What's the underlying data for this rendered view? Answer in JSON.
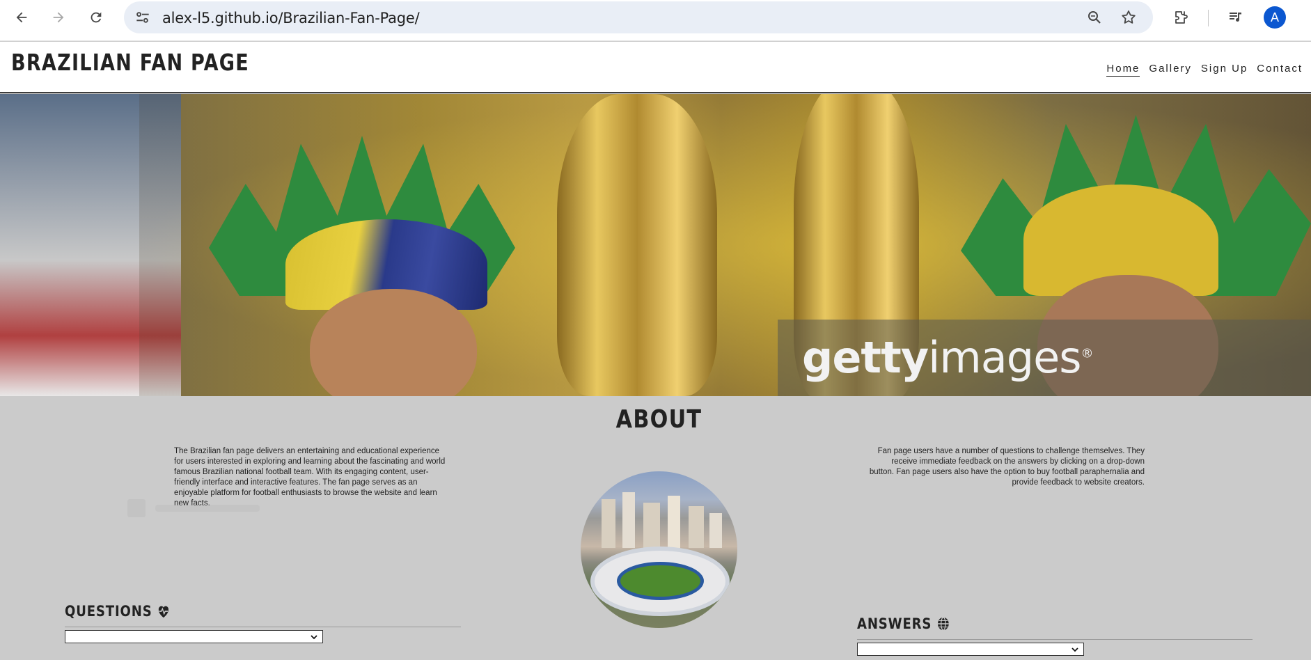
{
  "browser": {
    "url": "alex-l5.github.io/Brazilian-Fan-Page/",
    "avatar_letter": "A"
  },
  "site": {
    "brand": "BRAZILIAN FAN PAGE",
    "nav": [
      {
        "label": "Home",
        "active": true
      },
      {
        "label": "Gallery",
        "active": false
      },
      {
        "label": "Sign Up",
        "active": false
      },
      {
        "label": "Contact",
        "active": false
      }
    ]
  },
  "hero": {
    "watermark_bold": "getty",
    "watermark_light": "images",
    "watermark_mark": "®"
  },
  "about": {
    "title": "ABOUT",
    "left_text": "The Brazilian fan page delivers an entertaining and educational experience for users interested in exploring and learning about the fascinating and world famous Brazilian national football team. With its engaging content, user-friendly interface and interactive features. The fan page serves as an enjoyable platform for football enthusiasts to browse the website and learn new facts.",
    "right_text": "Fan page users have a number of questions to challenge themselves. They receive immediate feedback on the answers by clicking on a drop-down button. Fan page users also have the option to buy football paraphernalia and provide feedback to website creators."
  },
  "questions": {
    "title": "QUESTIONS",
    "icon": "heart-pulse-icon",
    "selected": ""
  },
  "answers": {
    "title": "ANSWERS",
    "icon": "globe-icon",
    "selected": ""
  },
  "colors": {
    "page_bg": "#cbcbcb",
    "omnibox_bg": "#e9eef6",
    "avatar_bg": "#0b57d0",
    "text": "#222222"
  }
}
